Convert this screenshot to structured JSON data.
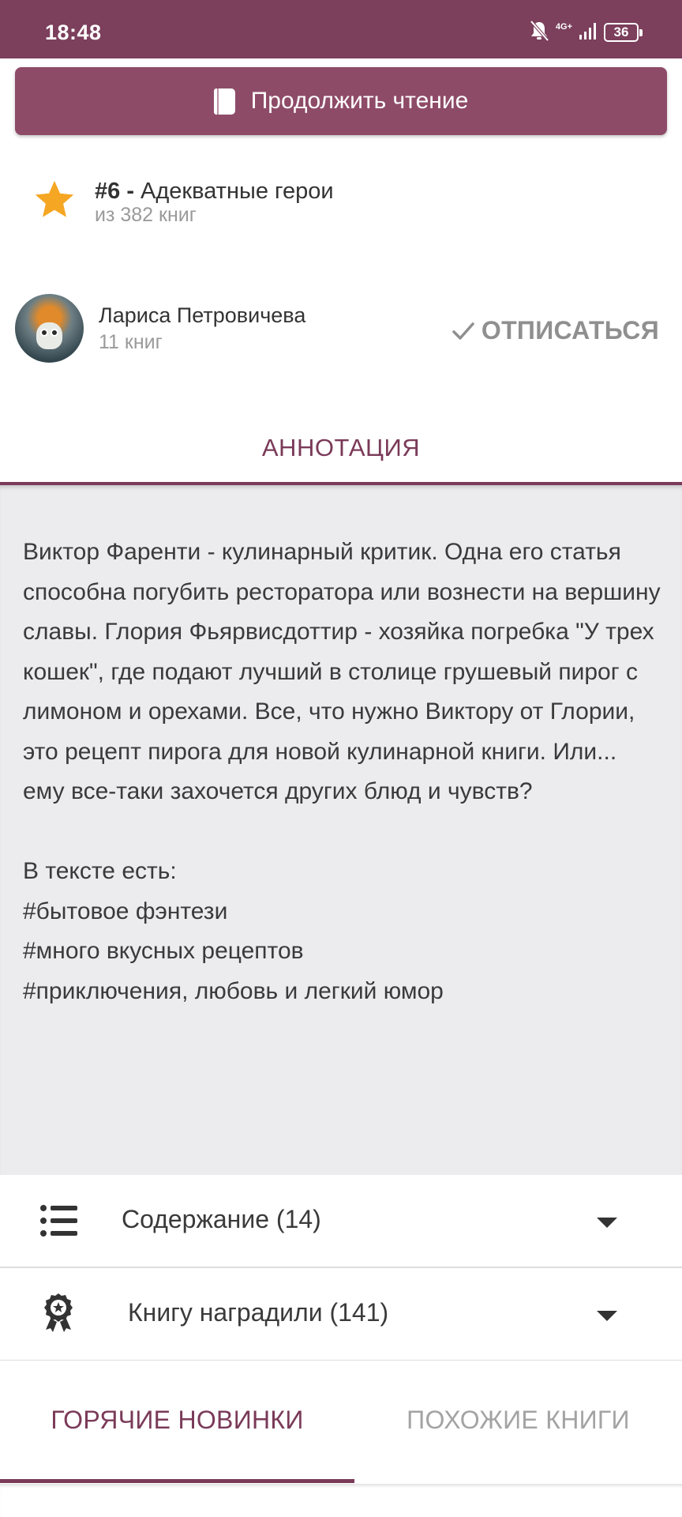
{
  "status_bar": {
    "time": "18:48",
    "network": "4G+",
    "battery": "36"
  },
  "continue_button": {
    "label": "Продолжить чтение",
    "icon": "book-icon"
  },
  "rank": {
    "icon": "star-icon",
    "number": "#6 - ",
    "category": "Адекватные герои",
    "subtitle": "из 382 книг"
  },
  "author": {
    "name": "Лариса Петровичева",
    "books": "11 книг",
    "unsubscribe_label": "ОТПИСАТЬСЯ"
  },
  "annotation": {
    "tab_label": "АННОТАЦИЯ",
    "text": "Виктор Фаренти - кулинарный критик. Одна его статья способна погубить ресторатора или вознести на вершину славы. Глория Фьярвисдоттир - хозяйка погребка \"У трех кошек\", где подают лучший в столице грушевый пирог с лимоном и орехами. Все, что нужно Виктору от Глории, это рецепт пирога для новой кулинарной книги. Или... ему все-таки захочется других блюд и чувств?\n\nВ тексте есть:\n#бытовое фэнтези\n#много вкусных рецептов\n#приключения, любовь и легкий юмор"
  },
  "accordions": [
    {
      "label": "Содержание (14)",
      "icon": "list-icon"
    },
    {
      "label": "Книгу наградили (141)",
      "icon": "award-icon"
    }
  ],
  "bottom_tabs": {
    "active": "ГОРЯЧИЕ НОВИНКИ",
    "inactive": "ПОХОЖИЕ КНИГИ"
  },
  "colors": {
    "brand": "#7c3f5c",
    "button": "#8e4b68",
    "accent_star": "#f5a623",
    "annotation_bg": "#ecebed"
  }
}
